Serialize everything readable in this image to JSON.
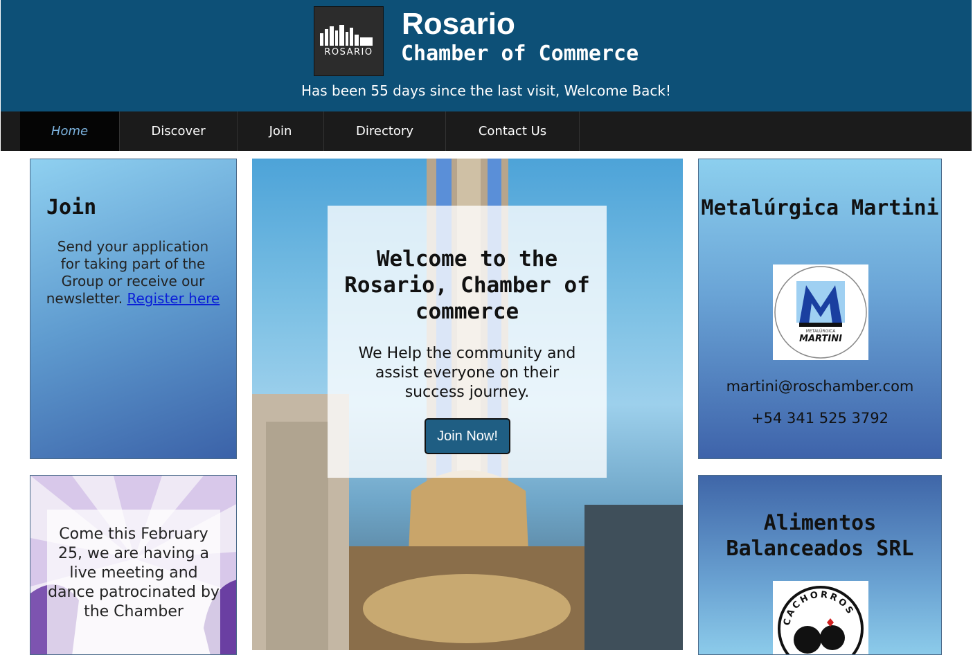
{
  "header": {
    "logo_text": "ROSARIO",
    "title": "Rosario",
    "subtitle": "Chamber of Commerce",
    "visit_message": "Has been 55 days since the last visit, Welcome Back!"
  },
  "nav": {
    "items": [
      {
        "label": "Home",
        "active": true
      },
      {
        "label": "Discover"
      },
      {
        "label": "Join"
      },
      {
        "label": "Directory"
      },
      {
        "label": "Contact Us"
      }
    ]
  },
  "join_card": {
    "title": "Join",
    "text": "Send your application for taking part of the Group or receive our newsletter.",
    "link_text": "Register here"
  },
  "event_card": {
    "text": "Come this February 25, we are having a live meeting and dance patrocinated by the Chamber"
  },
  "hero": {
    "title": "Welcome to the Rosario, Chamber of commerce",
    "text": "We Help the community and assist everyone on their success journey.",
    "button": "Join Now!"
  },
  "businesses": [
    {
      "name": "Metalúrgica Martini",
      "logo_text_top": "METALÚRGICA",
      "logo_text_bottom": "MARTINI",
      "email": "martini@roschamber.com",
      "phone": "+54 341 525 3792"
    },
    {
      "name": "Alimentos Balanceados SRL",
      "logo_text": "CACHORROS"
    }
  ],
  "colors": {
    "header_bg": "#0d5077",
    "nav_bg": "#1b1b1b",
    "nav_active_text": "#7db4e0",
    "button_bg": "#1f5e83"
  }
}
